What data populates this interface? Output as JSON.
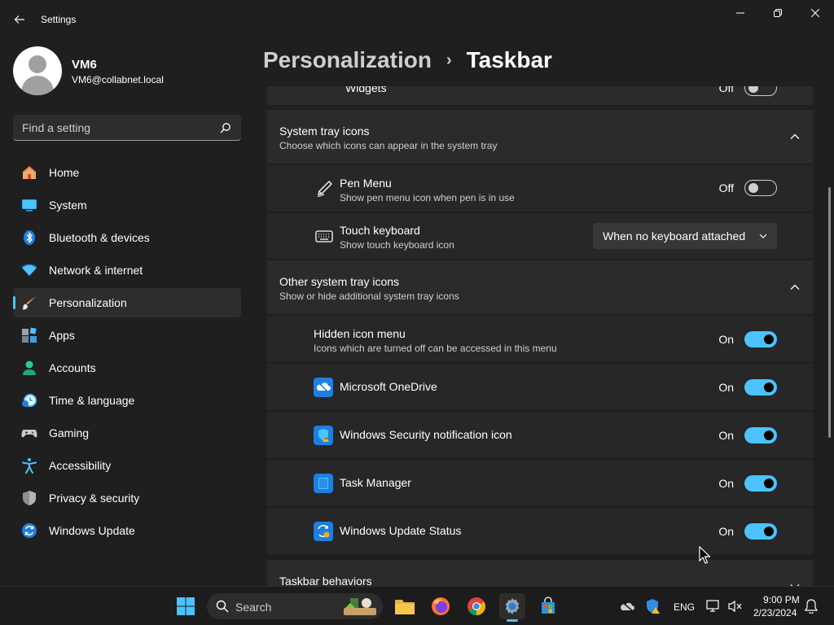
{
  "window": {
    "title": "Settings"
  },
  "profile": {
    "name": "VM6",
    "email": "VM6@collabnet.local"
  },
  "search": {
    "placeholder": "Find a setting"
  },
  "nav": {
    "items": [
      {
        "label": "Home",
        "icon": "home-icon"
      },
      {
        "label": "System",
        "icon": "system-icon"
      },
      {
        "label": "Bluetooth & devices",
        "icon": "bluetooth-icon"
      },
      {
        "label": "Network & internet",
        "icon": "wifi-icon"
      },
      {
        "label": "Personalization",
        "icon": "brush-icon",
        "active": true
      },
      {
        "label": "Apps",
        "icon": "apps-icon"
      },
      {
        "label": "Accounts",
        "icon": "accounts-icon"
      },
      {
        "label": "Time & language",
        "icon": "clock-icon"
      },
      {
        "label": "Gaming",
        "icon": "gamepad-icon"
      },
      {
        "label": "Accessibility",
        "icon": "accessibility-icon"
      },
      {
        "label": "Privacy & security",
        "icon": "shield-icon"
      },
      {
        "label": "Windows Update",
        "icon": "update-icon"
      }
    ]
  },
  "breadcrumb": {
    "parent": "Personalization",
    "separator": "›",
    "current": "Taskbar"
  },
  "partial_row": {
    "title": "Widgets",
    "state": "Off"
  },
  "system_tray": {
    "title": "System tray icons",
    "desc": "Choose which icons can appear in the system tray",
    "pen_menu": {
      "title": "Pen Menu",
      "desc": "Show pen menu icon when pen is in use",
      "state": "Off",
      "on": false
    },
    "touch_keyboard": {
      "title": "Touch keyboard",
      "desc": "Show touch keyboard icon",
      "value": "When no keyboard attached"
    }
  },
  "other_tray": {
    "title": "Other system tray icons",
    "desc": "Show or hide additional system tray icons",
    "hidden_menu": {
      "title": "Hidden icon menu",
      "desc": "Icons which are turned off can be accessed in this menu",
      "state": "On",
      "on": true
    },
    "items": [
      {
        "title": "Microsoft OneDrive",
        "state": "On",
        "on": true,
        "icon": "onedrive-icon"
      },
      {
        "title": "Windows Security notification icon",
        "state": "On",
        "on": true,
        "icon": "security-icon"
      },
      {
        "title": "Task Manager",
        "state": "On",
        "on": true,
        "icon": "task-manager-icon"
      },
      {
        "title": "Windows Update Status",
        "state": "On",
        "on": true,
        "icon": "update-status-icon"
      }
    ]
  },
  "behaviors": {
    "title": "Taskbar behaviors"
  },
  "taskbar": {
    "search_label": "Search",
    "language": "ENG",
    "time": "9:00 PM",
    "date": "2/23/2024"
  },
  "colors": {
    "accent": "#4cc2ff",
    "background": "#1f1f1f",
    "card": "#2b2b2b"
  }
}
